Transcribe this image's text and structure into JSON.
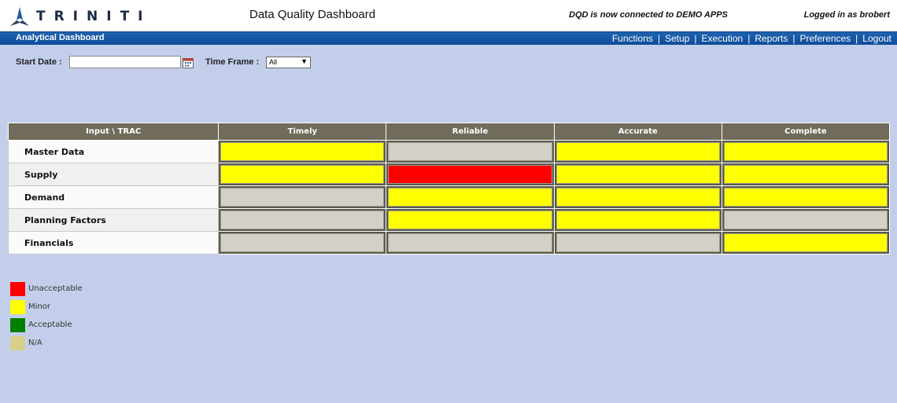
{
  "header": {
    "logo_text": "TRINITI",
    "app_title": "Data Quality Dashboard",
    "connection": "DQD is now connected to DEMO APPS",
    "login": "Logged in as brobert"
  },
  "nav": {
    "title": "Analytical Dashboard",
    "links": [
      "Functions",
      "Setup",
      "Execution",
      "Reports",
      "Preferences",
      "Logout"
    ]
  },
  "filters": {
    "start_date_label": "Start Date :",
    "start_date_value": "",
    "time_frame_label": "Time Frame :",
    "time_frame_value": "All"
  },
  "grid": {
    "headers": [
      "Input \\ TRAC",
      "Timely",
      "Reliable",
      "Accurate",
      "Complete"
    ],
    "rows": [
      {
        "label": "Master Data",
        "status": [
          "minor",
          "na",
          "minor",
          "minor"
        ]
      },
      {
        "label": "Supply",
        "status": [
          "minor",
          "unacceptable",
          "minor",
          "minor"
        ]
      },
      {
        "label": "Demand",
        "status": [
          "na",
          "minor",
          "minor",
          "minor"
        ]
      },
      {
        "label": "Planning Factors",
        "status": [
          "na",
          "minor",
          "minor",
          "na"
        ]
      },
      {
        "label": "Financials",
        "status": [
          "na",
          "na",
          "na",
          "minor"
        ]
      }
    ]
  },
  "status_colors": {
    "unacceptable": "#ff0000",
    "minor": "#ffff00",
    "acceptable": "#008000",
    "na": "#d4d0c8"
  },
  "legend": [
    {
      "label": "Unacceptable",
      "color": "#ff0000"
    },
    {
      "label": "Minor",
      "color": "#ffff00"
    },
    {
      "label": "Acceptable",
      "color": "#008000"
    },
    {
      "label": "N/A",
      "color": "#d8cf8a"
    }
  ]
}
